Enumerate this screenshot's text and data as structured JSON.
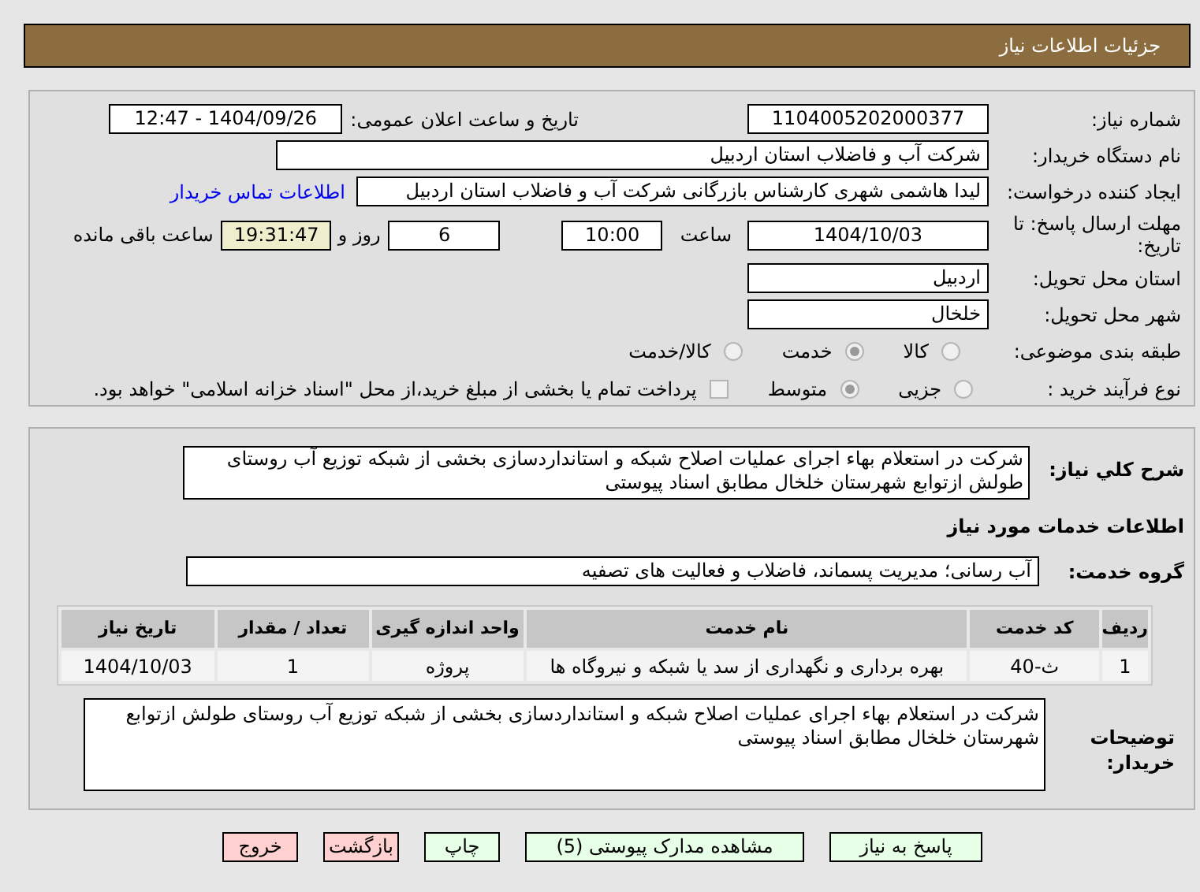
{
  "header": {
    "title": "جزئیات اطلاعات نیاز"
  },
  "need_number": {
    "label": "شماره نیاز:",
    "value": "1104005202000377"
  },
  "announce": {
    "label": "تاریخ و ساعت اعلان عمومی:",
    "value": "1404/09/26 - 12:47"
  },
  "buyer_org": {
    "label": "نام دستگاه خریدار:",
    "value": "شرکت آب و فاضلاب استان اردبیل"
  },
  "requester": {
    "label": "ایجاد کننده درخواست:",
    "value": "لیدا  هاشمی شهری کارشناس بازرگانی شرکت آب و فاضلاب استان اردبیل",
    "link": "اطلاعات تماس خریدار"
  },
  "deadline": {
    "label": "مهلت ارسال پاسخ: تا تاریخ:",
    "date": "1404/10/03",
    "time_label": "ساعت",
    "time": "10:00",
    "days": "6",
    "days_label": "روز و",
    "remaining": "19:31:47",
    "remaining_label": "ساعت باقی مانده"
  },
  "province": {
    "label": "استان محل تحویل:",
    "value": "اردبیل"
  },
  "city": {
    "label": "شهر محل تحویل:",
    "value": "خلخال"
  },
  "category": {
    "label": "طبقه بندی موضوعی:",
    "options": [
      {
        "label": "کالا",
        "selected": false
      },
      {
        "label": "خدمت",
        "selected": true
      },
      {
        "label": "کالا/خدمت",
        "selected": false
      }
    ]
  },
  "process": {
    "label": "نوع فرآیند خرید :",
    "options": [
      {
        "label": "جزیی",
        "selected": false
      },
      {
        "label": "متوسط",
        "selected": true
      }
    ],
    "checkbox": {
      "label": "پرداخت تمام یا بخشی از مبلغ خرید،از محل \"اسناد خزانه اسلامی\" خواهد بود.",
      "checked": false
    }
  },
  "description": {
    "label": "شرح کلي نیاز:",
    "value": "شرکت در استعلام بهاء اجرای عملیات اصلاح شبکه و استانداردسازی بخشی از شبکه توزیع آب روستای طولش ازتوابع شهرستان خلخال مطابق اسناد پیوستی"
  },
  "services_heading": "اطلاعات خدمات مورد نیاز",
  "service_group": {
    "label": "گروه خدمت:",
    "value": "آب رسانی؛ مدیریت پسماند، فاضلاب و فعالیت های تصفیه"
  },
  "table": {
    "columns": [
      "ردیف",
      "کد خدمت",
      "نام خدمت",
      "واحد اندازه گیری",
      "تعداد / مقدار",
      "تاریخ نیاز"
    ],
    "rows": [
      [
        "1",
        "ث-40",
        "بهره برداری و نگهداری از سد یا شبکه و نیروگاه ها",
        "پروژه",
        "1",
        "1404/10/03"
      ]
    ]
  },
  "buyer_notes": {
    "label": "توضیحات خریدار:",
    "value": "شرکت در استعلام بهاء اجرای عملیات اصلاح شبکه و استانداردسازی بخشی از شبکه توزیع آب روستای طولش ازتوابع شهرستان خلخال مطابق اسناد پیوستی"
  },
  "buttons": [
    {
      "label": "پاسخ به نیاز",
      "kind": "action"
    },
    {
      "label": "مشاهده مدارک پیوستی (5)",
      "kind": "action"
    },
    {
      "label": "چاپ",
      "kind": "action"
    },
    {
      "label": "بازگشت",
      "kind": "exit"
    },
    {
      "label": "خروج",
      "kind": "exit"
    }
  ]
}
